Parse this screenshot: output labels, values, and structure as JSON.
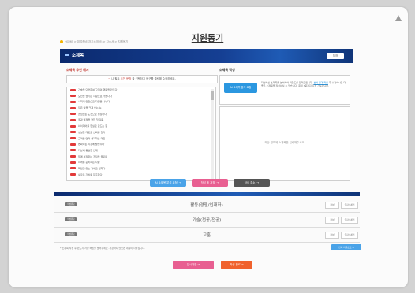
{
  "page": {
    "title": "지원동기",
    "breadcrumb": "HOME > 취업준비(자기소개서) > 자소서 > 지원동기"
  },
  "banner": {
    "title": "소제목",
    "button_label": "저장"
  },
  "left": {
    "heading": "소제목 추천 예시",
    "notice_prefix": "나 필요",
    "notice_highlight": "추천 문장",
    "notice_suffix": " 을 선택하고 문구를 클릭해 수정하세요.",
    "items": [
      "기술을 단련하여 고객의 행복을 만드다",
      "도전을 즐기는 사람으로 거듭나다",
      "사회의 일원으로 자원을 나누다",
      "작은 일을 크게 보는 눈",
      "끊임없는 도전으로 성장하다",
      "꿈과 열정을 향한 첫 걸음",
      "아이디어를 현실로 만드는 힘",
      "성실한 태도로 신뢰를 얻다",
      "고객을 먼저 생각하는 마음",
      "변화하는 시장에 발맞추다",
      "기본에 충실한 인재",
      "함께 성장하는 조직을 꿈꾸며",
      "미래를 준비하는 사람",
      "책임감 있는 자세로 임하다",
      "새로운 가치를 창출하다"
    ]
  },
  "right": {
    "heading": "소제목 작성",
    "analyze_button": "AI 소제목 분석 요청",
    "info_text_1": "작성하신 소제목을 분석하여 적합도를 알려드립니다. ",
    "info_link": "분석 결과 확인",
    "info_text_2": " 후 수정하시면 더 좋은 소제목을 작성하실 수 있습니다. 최대 3회까지 요청 가능합니다.",
    "editor_placeholder": "해당 영역에 소제목을 입력해주세요."
  },
  "actions": {
    "btn_analyze": "AI 소제목 분석 요청",
    "btn_save": "작성 후 저장",
    "btn_reset": "작성 취소"
  },
  "categories": [
    {
      "badge": "작성완료",
      "label": "활동(경쟁/인재화)",
      "btn1": "작성",
      "btn2": "글자수세기"
    },
    {
      "badge": "작성완료",
      "label": "기술(전공/전공)",
      "btn1": "작성",
      "btn2": "글자수세기"
    },
    {
      "badge": "작성완료",
      "label": "교훈",
      "btn1": "작성",
      "btn2": "글자수세기"
    }
  ],
  "footnote": "* 소제목 작성 후 반드시 저장 버튼을 눌러주세요. 저장하지 않으면 내용이 사라집니다.",
  "download_button": "전체 다운로드",
  "bottom": {
    "temp_save": "임시저장",
    "submit": "작성 완료"
  },
  "colors": {
    "banner": "#153f93",
    "accent_blue": "#4aa3e8",
    "pink": "#e85f91",
    "dark_gray": "#555555",
    "orange": "#f0622d",
    "red_badge": "#e23a3a"
  }
}
